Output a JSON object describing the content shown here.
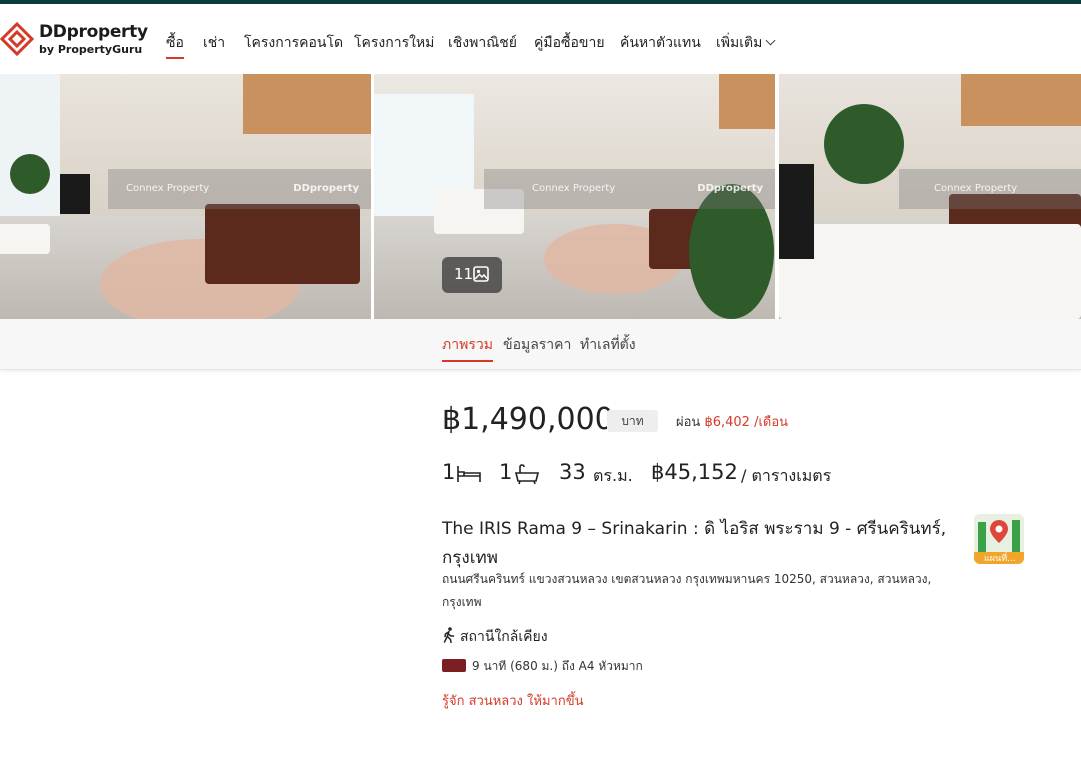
{
  "brand": {
    "name": "DDproperty",
    "tagline": "by PropertyGuru",
    "accent_color": "#d63a27",
    "topline_color": "#0b3b3c"
  },
  "nav": {
    "items": [
      "ซื้อ",
      "เช่า",
      "โครงการคอนโด",
      "โครงการใหม่",
      "เชิงพาณิชย์",
      "คู่มือซื้อขาย",
      "ค้นหาตัวแทน",
      "เพิ่มเติม"
    ],
    "active": "ซื้อ"
  },
  "gallery": {
    "watermark_agent": "Connex Property",
    "watermark_brand": "DDproperty",
    "photo_count": "11"
  },
  "tabs": {
    "items": [
      "ภาพรวม",
      "ข้อมูลราคา",
      "ทำเลที่ตั้ง"
    ],
    "active": "ภาพรวม"
  },
  "listing": {
    "price": "฿1,490,000",
    "price_unit": "บาท",
    "installment_label": "ผ่อน",
    "installment_amount": "฿6,402 /เดือน",
    "bedrooms": "1",
    "bathrooms": "1",
    "area_value": "33",
    "area_unit": "ตร.ม.",
    "price_per_area": "฿45,152",
    "price_per_area_unit": "/ ตารางเมตร",
    "title": "The IRIS Rama 9 – Srinakarin : ดิ ไอริส พระราม 9 - ศรีนครินทร์, กรุงเทพ",
    "address": "ถนนศรีนครินทร์ แขวงสวนหลวง เขตสวนหลวง กรุงเทพมหานคร 10250, สวนหลวง, สวนหลวง, กรุงเทพ",
    "map_label": "แผนที่..."
  },
  "nearby": {
    "heading": "สถานีใกล้เคียง",
    "station_text": "9 นาที (680 ม.) ถึง A4 หัวหมาก",
    "line_color": "#7a1f22"
  },
  "more_link": "รู้จัก สวนหลวง ให้มากขึ้น"
}
